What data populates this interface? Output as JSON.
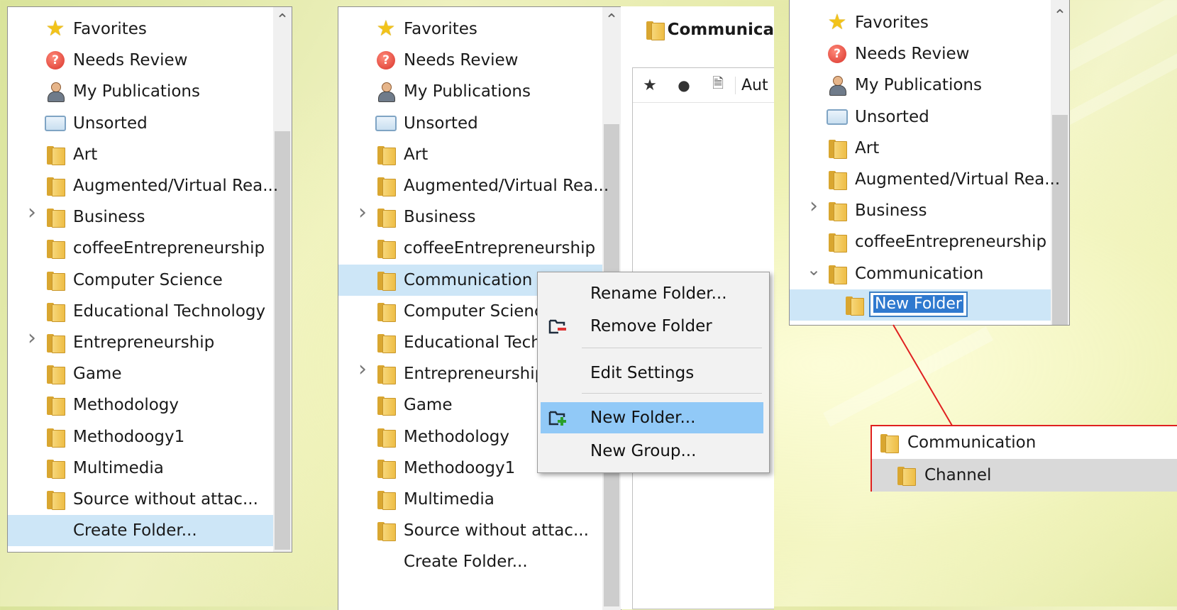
{
  "panel1": {
    "items": [
      {
        "label": "Favorites",
        "icon": "star-icon"
      },
      {
        "label": "Needs Review",
        "icon": "needs-review-icon"
      },
      {
        "label": "My Publications",
        "icon": "person-icon"
      },
      {
        "label": "Unsorted",
        "icon": "tray-icon"
      },
      {
        "label": "Art",
        "icon": "folder-icon"
      },
      {
        "label": "Augmented/Virtual Rea...",
        "icon": "folder-icon"
      },
      {
        "label": "Business",
        "icon": "folder-icon",
        "expandable": true
      },
      {
        "label": "coffeeEntrepreneurship",
        "icon": "folder-icon"
      },
      {
        "label": "Computer Science",
        "icon": "folder-icon"
      },
      {
        "label": "Educational Technology",
        "icon": "folder-icon"
      },
      {
        "label": "Entrepreneurship",
        "icon": "folder-icon",
        "expandable": true
      },
      {
        "label": "Game",
        "icon": "folder-icon"
      },
      {
        "label": "Methodology",
        "icon": "folder-icon"
      },
      {
        "label": "Methodoogy1",
        "icon": "folder-icon"
      },
      {
        "label": "Multimedia",
        "icon": "folder-icon"
      },
      {
        "label": "Source without attac...",
        "icon": "folder-icon"
      },
      {
        "label": "Create Folder...",
        "icon": "",
        "selected": true
      }
    ]
  },
  "panel2": {
    "items": [
      {
        "label": "Favorites",
        "icon": "star-icon"
      },
      {
        "label": "Needs Review",
        "icon": "needs-review-icon"
      },
      {
        "label": "My Publications",
        "icon": "person-icon"
      },
      {
        "label": "Unsorted",
        "icon": "tray-icon"
      },
      {
        "label": "Art",
        "icon": "folder-icon"
      },
      {
        "label": "Augmented/Virtual Rea...",
        "icon": "folder-icon"
      },
      {
        "label": "Business",
        "icon": "folder-icon",
        "expandable": true
      },
      {
        "label": "coffeeEntrepreneurship",
        "icon": "folder-icon"
      },
      {
        "label": "Communication",
        "icon": "folder-icon",
        "selected": true
      },
      {
        "label": "Computer Science",
        "icon": "folder-icon"
      },
      {
        "label": "Educational Techno",
        "icon": "folder-icon"
      },
      {
        "label": "Entrepreneurship",
        "icon": "folder-icon",
        "expandable": true
      },
      {
        "label": "Game",
        "icon": "folder-icon"
      },
      {
        "label": "Methodology",
        "icon": "folder-icon"
      },
      {
        "label": "Methodoogy1",
        "icon": "folder-icon"
      },
      {
        "label": "Multimedia",
        "icon": "folder-icon"
      },
      {
        "label": "Source without attac...",
        "icon": "folder-icon"
      },
      {
        "label": "Create Folder...",
        "icon": ""
      }
    ],
    "detail_title": "Communica",
    "column_header_text": "Aut"
  },
  "context_menu": {
    "items": [
      {
        "label": "Rename Folder...",
        "icon": ""
      },
      {
        "label": "Remove Folder",
        "icon": "remove-folder-icon"
      },
      {
        "label": "Edit Settings",
        "icon": ""
      },
      {
        "label": "New Folder...",
        "icon": "new-folder-icon",
        "highlighted": true
      },
      {
        "label": "New Group...",
        "icon": ""
      }
    ]
  },
  "panel3": {
    "items": [
      {
        "label": "Favorites",
        "icon": "star-icon"
      },
      {
        "label": "Needs Review",
        "icon": "needs-review-icon"
      },
      {
        "label": "My Publications",
        "icon": "person-icon"
      },
      {
        "label": "Unsorted",
        "icon": "tray-icon"
      },
      {
        "label": "Art",
        "icon": "folder-icon"
      },
      {
        "label": "Augmented/Virtual Rea...",
        "icon": "folder-icon"
      },
      {
        "label": "Business",
        "icon": "folder-icon",
        "expandable": true
      },
      {
        "label": "coffeeEntrepreneurship",
        "icon": "folder-icon"
      },
      {
        "label": "Communication",
        "icon": "folder-icon",
        "expanded": true
      }
    ],
    "rename_value": "New Folder"
  },
  "callout": {
    "parent_label": "Communication",
    "child_label": "Channel"
  },
  "colors": {
    "selection": "#cde6f7",
    "menu_highlight": "#91c9f7",
    "callout_border": "#e02020"
  }
}
